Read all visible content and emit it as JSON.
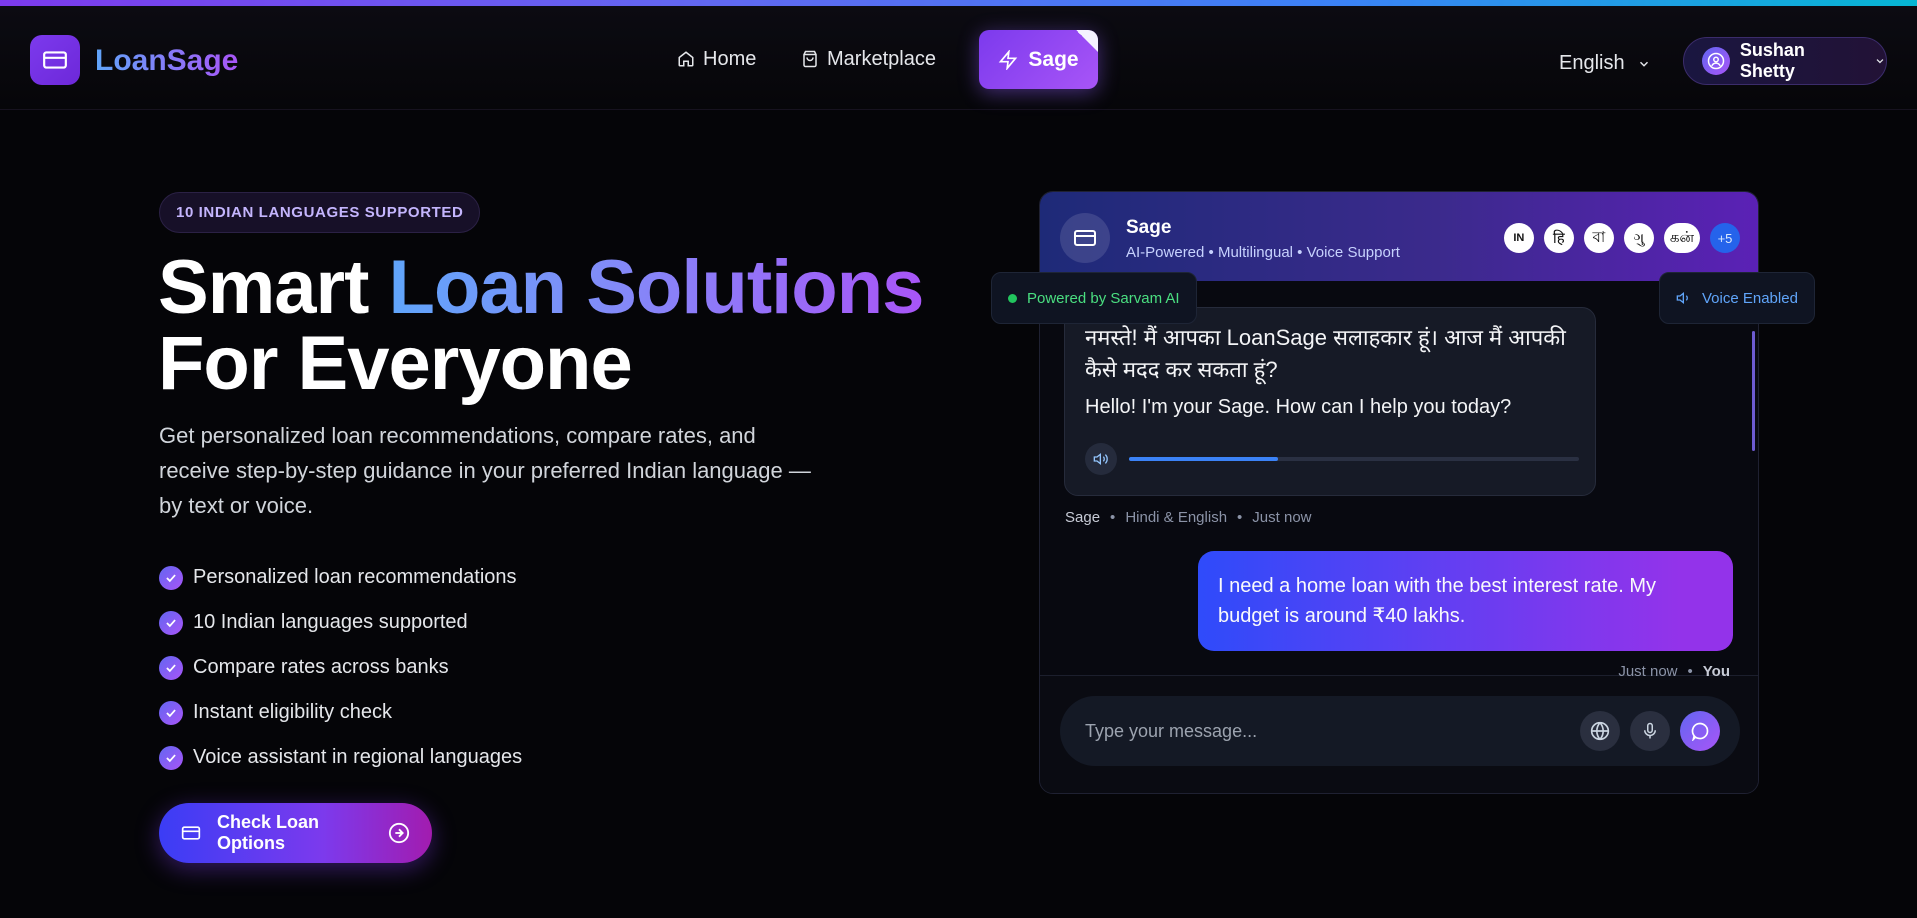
{
  "brand": {
    "name": "LoanSage",
    "logo_icon": "card-icon",
    "accent": "#7c3aed"
  },
  "nav": {
    "home": "Home",
    "marketplace": "Marketplace",
    "sage": "Sage"
  },
  "language": {
    "selected": "English"
  },
  "user": {
    "name": "Sushan Shetty"
  },
  "hero": {
    "badge": "10 INDIAN LANGUAGES SUPPORTED",
    "title_part1": "Smart ",
    "title_grad": "Loan Solutions",
    "title_line2": "For Everyone",
    "description": "Get personalized loan recommendations, compare rates, and receive step-by-step guidance in your preferred Indian language — by text or voice.",
    "features": [
      "Personalized loan recommendations",
      "10 Indian languages supported",
      "Compare rates across banks",
      "Instant eligibility check",
      "Voice assistant in regional languages"
    ],
    "cta": "Check Loan Options"
  },
  "chat": {
    "bot_name": "Sage",
    "bot_subtitle": "AI-Powered • Multilingual • Voice Support",
    "languages": [
      "IN",
      "हि",
      "বা",
      "ગુ",
      "கன்"
    ],
    "more_languages": "+5",
    "powered_by": "Powered by Sarvam AI",
    "voice_status": "Voice Enabled",
    "bot_message_hi": "नमस्ते! मैं आपका LoanSage सलाहकार हूं। आज मैं आपकी कैसे मदद कर सकता हूं?",
    "bot_message_en": "Hello! I'm your Sage. How can I help you today?",
    "audio_progress": 0.33,
    "bot_meta": {
      "name": "Sage",
      "lang": "Hindi & English",
      "time": "Just now"
    },
    "user_message": "I need a home loan with the best interest rate. My budget is around ₹40 lakhs.",
    "user_meta": {
      "time": "Just now",
      "name": "You"
    },
    "input_placeholder": "Type your message..."
  }
}
